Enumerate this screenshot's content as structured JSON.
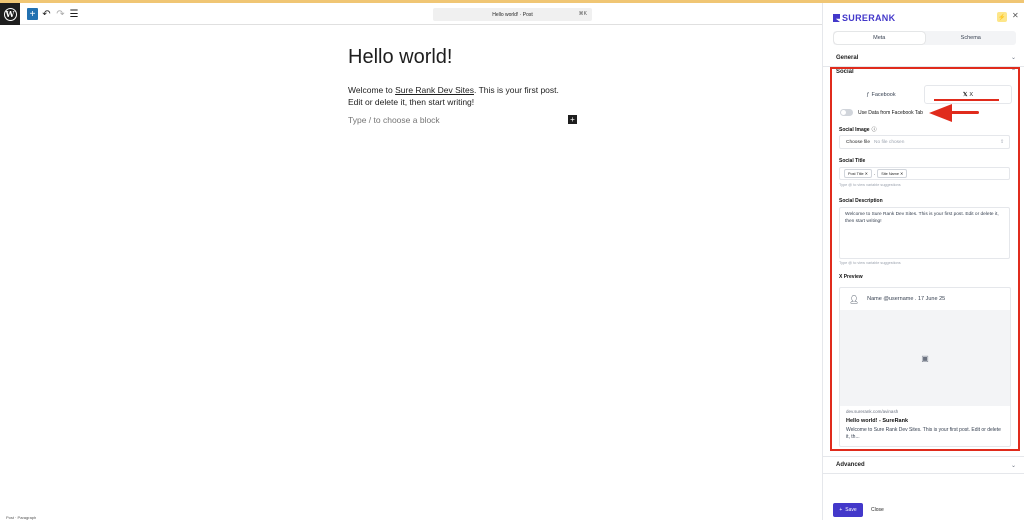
{
  "editor": {
    "doc_title": "Hello world! · Post",
    "shortcut": "⌘K",
    "post_title": "Hello world!",
    "body_before_link": "Welcome to ",
    "body_link": "Sure Rank Dev Sites",
    "body_after_link": ". This is your first post. Edit or delete it, then start writing!",
    "placeholder": "Type / to choose a block",
    "status": "Post · Paragraph"
  },
  "panel": {
    "brand": "SURERANK",
    "tabs": [
      "Meta",
      "Schema"
    ],
    "active_tab": "Meta",
    "general_label": "General",
    "social_label": "Social",
    "advanced_label": "Advanced",
    "sub_tabs": [
      "Facebook",
      "X"
    ],
    "active_sub_tab": "X",
    "toggle_label": "Use Data from Facebook Tab",
    "social_image_label": "Social Image",
    "choose_file": "Choose file",
    "no_file": "No file chosen",
    "social_title_label": "Social Title",
    "title_chips": [
      "Post Title",
      "Site Name"
    ],
    "title_separator": "-",
    "title_hint": "Type @ to view variable suggestions",
    "social_desc_label": "Social Description",
    "social_desc_value": "Welcome to Sure Rank Dev Sites. This is your first post. Edit or delete it, then start writing!",
    "desc_hint": "Type @ to view variable suggestions",
    "preview_label": "X Preview",
    "preview_user": "Name @username . 17 June 25",
    "preview_domain": "dev.surerank.com/avinash",
    "preview_title": "Hello world! - SureRank",
    "preview_desc": "Welcome to Sure Rank Dev Sites. This is your first post. Edit or delete it, th...",
    "save_label": "Save",
    "close_label": "Close"
  },
  "colors": {
    "accent": "#4338ca",
    "annotation": "#e02b1c",
    "wp_blue": "#2271b1"
  }
}
